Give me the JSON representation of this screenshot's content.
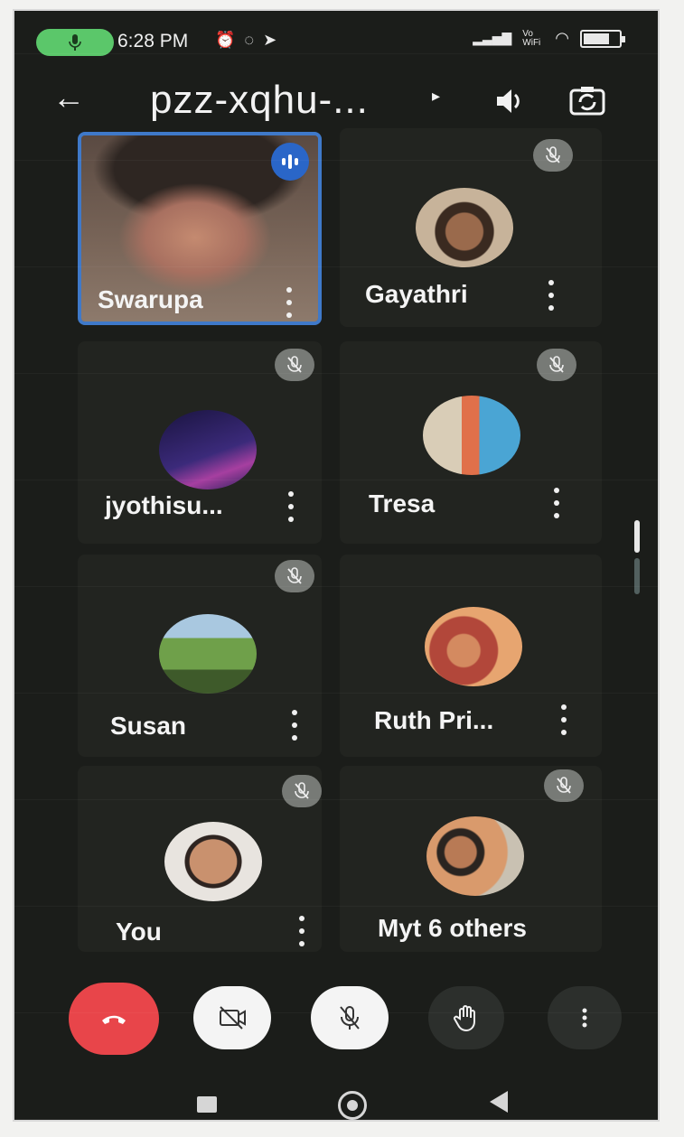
{
  "status_bar": {
    "time": "6:28 PM",
    "notification_icons": [
      "alarm-icon",
      "whatsapp-icon",
      "telegram-icon"
    ],
    "network_label": "Vo WiFi",
    "battery_level": 0.6
  },
  "app_bar": {
    "meeting_code": "pzz-xqhu-...",
    "icons": [
      "back-arrow-icon",
      "speaker-icon",
      "switch-camera-icon"
    ]
  },
  "participants": [
    {
      "name": "Swarupa",
      "speaking": true,
      "muted": false
    },
    {
      "name": "Gayathri",
      "muted": true
    },
    {
      "name": "jyothisu...",
      "muted": true
    },
    {
      "name": "Tresa",
      "muted": true
    },
    {
      "name": "Susan",
      "muted": true
    },
    {
      "name": "Ruth Pri...",
      "muted": true
    },
    {
      "name": "You",
      "muted": true
    },
    {
      "name": "Myt  6 others",
      "muted": true
    }
  ],
  "controls": {
    "icons": [
      "end-call-icon",
      "camera-off-icon",
      "mic-off-icon",
      "raise-hand-icon",
      "more-vert-icon"
    ]
  },
  "colors": {
    "background": "#1b1d1a",
    "end_call": "#e8454a",
    "active_speaker_border": "#3f79c9",
    "status_mic": "#5bc76a"
  }
}
